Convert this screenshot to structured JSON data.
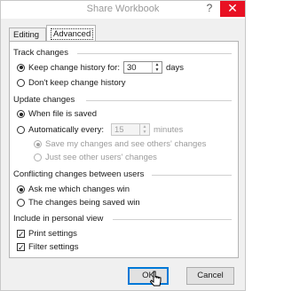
{
  "window": {
    "title": "Share Workbook",
    "help_glyph": "?",
    "close_glyph": "✕"
  },
  "tabs": [
    {
      "label": "Editing",
      "selected": false
    },
    {
      "label": "Advanced",
      "selected": true
    }
  ],
  "track_changes": {
    "heading": "Track changes",
    "keep_label": "Keep change history for:",
    "keep_value": "30",
    "keep_unit": "days",
    "dont_keep_label": "Don't keep change history"
  },
  "update_changes": {
    "heading": "Update changes",
    "when_saved_label": "When file is saved",
    "auto_label": "Automatically every:",
    "auto_value": "15",
    "auto_unit": "minutes",
    "save_mine_label": "Save my changes and see others' changes",
    "just_see_label": "Just see other users' changes"
  },
  "conflicting": {
    "heading": "Conflicting changes between users",
    "ask_label": "Ask me which changes win",
    "being_saved_label": "The changes being saved win"
  },
  "personal_view": {
    "heading": "Include in personal view",
    "print_label": "Print settings",
    "filter_label": "Filter settings"
  },
  "buttons": {
    "ok": "OK",
    "cancel": "Cancel"
  },
  "colors": {
    "accent": "#0078d7",
    "close": "#e81123"
  }
}
